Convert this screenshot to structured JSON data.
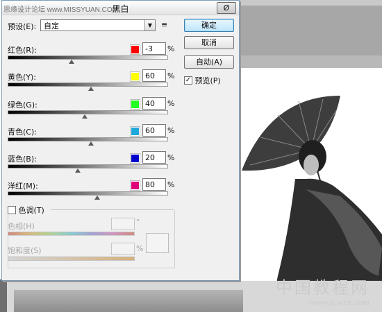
{
  "watermark": {
    "big": "中国教程网",
    "small": "www.jcwcn.com"
  },
  "dialog": {
    "title": "黑白",
    "site_mark": "思缘设计论坛  www.MISSYUAN.COM",
    "close_label": "Ø",
    "preset": {
      "label": "预设(E):",
      "value": "自定"
    },
    "buttons": {
      "ok": "确定",
      "cancel": "取消",
      "auto": "自动(A)"
    },
    "preview": {
      "label": "预览(P)",
      "checked": true
    },
    "sliders": [
      {
        "label": "红色(R):",
        "value": "-3",
        "color": "#ff0000",
        "pos": 0.4
      },
      {
        "label": "黄色(Y):",
        "value": "60",
        "color": "#ffff00",
        "pos": 0.52
      },
      {
        "label": "绿色(G):",
        "value": "40",
        "color": "#00ff00",
        "pos": 0.48
      },
      {
        "label": "青色(C):",
        "value": "60",
        "color": "#00aaff",
        "pos": 0.52
      },
      {
        "label": "蓝色(B):",
        "value": "20",
        "color": "#0000cc",
        "pos": 0.44
      },
      {
        "label": "洋红(M):",
        "value": "80",
        "color": "#e0007a",
        "pos": 0.56
      }
    ],
    "percent": "%",
    "tint": {
      "label": "色调(T)",
      "hue_label": "色相(H)",
      "sat_label": "饱和度(S)",
      "degree": "°",
      "percent": "%"
    }
  }
}
